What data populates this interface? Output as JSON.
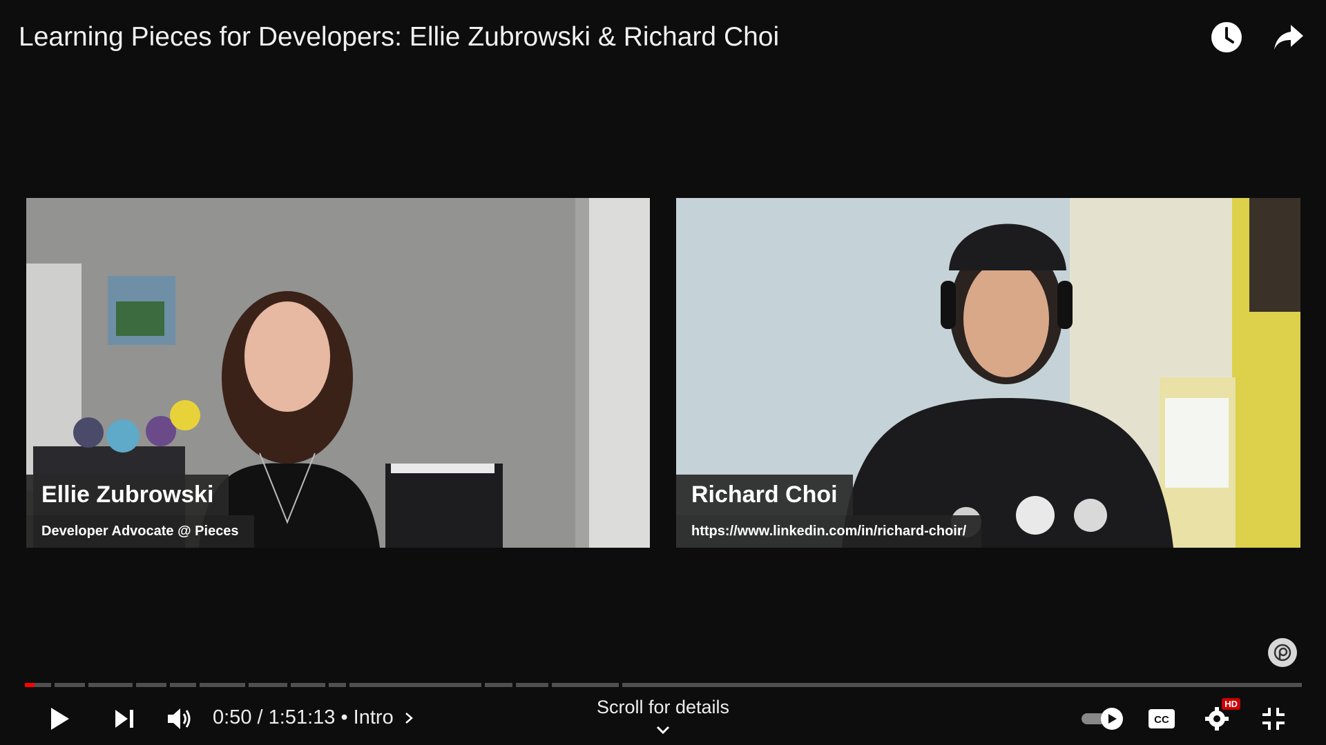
{
  "video": {
    "title": "Learning Pieces for Developers: Ellie Zubrowski & Richard Choi"
  },
  "participants": [
    {
      "name": "Ellie Zubrowski",
      "subtitle": "Developer Advocate @ Pieces"
    },
    {
      "name": "Richard Choi",
      "subtitle": "https://www.linkedin.com/in/richard-choir/"
    }
  ],
  "controls": {
    "time_current": "0:50",
    "time_separator": " / ",
    "time_total": "1:51:13",
    "chapter_separator": " • ",
    "chapter": "Intro",
    "scroll_hint": "Scroll for details",
    "hd_badge": "HD"
  },
  "progress": {
    "played_fraction": 0.0075
  },
  "icons": {
    "watch_later": "clock-icon",
    "share": "share-arrow-icon",
    "play": "play-icon",
    "next": "next-icon",
    "volume": "volume-icon",
    "autoplay": "autoplay-toggle-icon",
    "captions": "cc-icon",
    "settings": "gear-icon",
    "exit_fullscreen": "exit-fullscreen-icon",
    "channel_watermark": "pieces-logo-icon"
  },
  "colors": {
    "progress_played": "#ff0000",
    "hd_badge": "#cc0000"
  }
}
